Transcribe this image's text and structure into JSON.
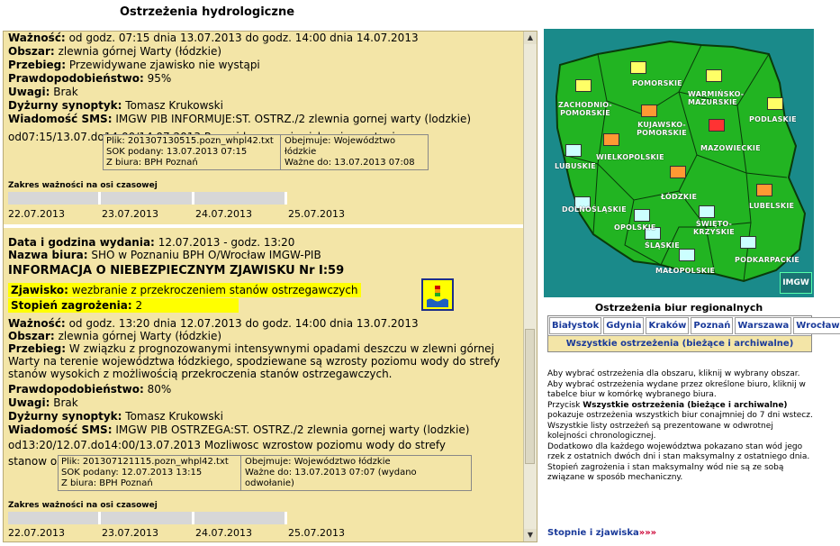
{
  "page_title": "Ostrzeżenia hydrologiczne",
  "record1": {
    "waznosc_label": "Ważność:",
    "waznosc_value": "od godz. 07:15 dnia 13.07.2013 do godz. 14:00 dnia 14.07.2013",
    "obszar_label": "Obszar:",
    "obszar_value": "zlewnia górnej Warty (łódzkie)",
    "przebieg_label": "Przebieg:",
    "przebieg_value": "Przewidywane zjawisko nie wystąpi",
    "prawdop_label": "Prawdopodobieństwo:",
    "prawdop_value": "95%",
    "uwagi_label": "Uwagi:",
    "uwagi_value": "Brak",
    "synoptyk_label": "Dyżurny synoptyk:",
    "synoptyk_value": "Tomasz Krukowski",
    "sms_label": "Wiadomość SMS:",
    "sms_value": "IMGW PIB INFORMUJE:ST. OSTRZ./2 zlewnia gornej warty (lodzkie)",
    "sms_cont": "od07:15/13.07.do14:00/14.07.2013 Przewidywane zjawisko nie wystapi",
    "plik": "Plik: 201307130515.pozn_whpl42.txt",
    "sok": "SOK podany: 13.07.2013 07:15",
    "biuro": "Z biura: BPH Poznań",
    "obejmuje": "Obejmuje: Województwo łódzkie",
    "wazne_do": "Ważne do: 13.07.2013 07:08",
    "zakres": "Zakres ważności na osi czasowej",
    "dates": [
      "22.07.2013",
      "23.07.2013",
      "24.07.2013",
      "25.07.2013"
    ]
  },
  "record2": {
    "data_label": "Data i godzina wydania:",
    "data_value": "12.07.2013 - godz. 13:20",
    "biuro_label": "Nazwa biura:",
    "biuro_value": "SHO w Poznaniu BPH O/Wrocław IMGW-PIB",
    "heading": "INFORMACJA O NIEBEZPIECZNYM ZJAWISKU Nr I:59",
    "zjawisko_label": "Zjawisko:",
    "zjawisko_value": "wezbranie z przekroczeniem stanów ostrzegawczych",
    "stopien_label": "Stopień zagrożenia:",
    "stopien_value": "2",
    "waznosc_label": "Ważność:",
    "waznosc_value": "od godz. 13:20 dnia 12.07.2013 do godz. 14:00 dnia 13.07.2013",
    "obszar_label": "Obszar:",
    "obszar_value": "zlewnia górnej Warty (łódzkie)",
    "przebieg_label": "Przebieg:",
    "przebieg_value": "W związku z prognozowanymi intensywnymi opadami deszczu w zlewni górnej Warty na terenie województwa łódzkiego, spodziewane są wzrosty poziomu wody do strefy stanów wysokich z możliwością przekroczenia stanów ostrzegawczych.",
    "prawdop_label": "Prawdopodobieństwo:",
    "prawdop_value": "80%",
    "uwagi_label": "Uwagi:",
    "uwagi_value": "Brak",
    "synoptyk_label": "Dyżurny synoptyk:",
    "synoptyk_value": "Tomasz Krukowski",
    "sms_label": "Wiadomość SMS:",
    "sms_value": "IMGW PIB OSTRZEGA:ST. OSTRZ./2 zlewnia gornej warty (lodzkie)",
    "sms_cont": "od13:20/12.07.do14:00/13.07.2013 Mozliwosc wzrostow poziomu wody do strefy stanow ostrzegawczych",
    "plik": "Plik: 201307121115.pozn_whpl42.txt",
    "sok": "SOK podany: 12.07.2013 13:15",
    "biuro": "Z biura: BPH Poznań",
    "obejmuje": "Obejmuje: Województwo łódzkie",
    "wazne_do": "Ważne do: 13.07.2013 07:07 (wydano odwołanie)",
    "zakres": "Zakres ważności na osi czasowej",
    "dates": [
      "22.07.2013",
      "23.07.2013",
      "24.07.2013",
      "25.07.2013"
    ]
  },
  "map": {
    "regions": [
      "ZACHODNIO-POMORSKIE",
      "POMORSKIE",
      "WARMIŃSKO-MAZURSKIE",
      "PODLASKIE",
      "KUJAWSKO-POMORSKIE",
      "MAZOWIECKIE",
      "LUBUSKIE",
      "WIELKOPOLSKIE",
      "ŁÓDZKIE",
      "LUBELSKIE",
      "DOLNOŚLĄSKIE",
      "OPOLSKIE",
      "ŚLĄSKIE",
      "ŚWIĘTO-KRZYSKIE",
      "PODKARPACKIE",
      "MAŁOPOLSKIE"
    ],
    "logo": "IMGW",
    "colors": {
      "land": "#22b422",
      "sea": "#1a8a8a",
      "border": "#0a3a0a",
      "alert": "#ff0000"
    }
  },
  "regional": {
    "title": "Ostrzeżenia biur regionalnych",
    "offices": [
      "Białystok",
      "Gdynia",
      "Kraków",
      "Poznań",
      "Warszawa",
      "Wrocław"
    ],
    "all_link": "Wszystkie ostrzeżenia (bieżące i archiwalne)"
  },
  "help": {
    "p1": "Aby wybrać ostrzeżenia dla obszaru, kliknij w wybrany obszar.",
    "p2": "Aby wybrać ostrzeżenia wydane przez określone biuro, kliknij w tabelce biur w komórkę wybranego biura.",
    "p3_pre": "Przycisk ",
    "p3_bold": "Wszystkie ostrzeżenia (bieżące i archiwalne)",
    "p3_post": " pokazuje ostrzeżenia wszystkich biur conajmniej do 7 dni wstecz.",
    "p4": "Wszystkie listy ostrzeżeń są prezentowane w odwrotnej kolejności chronologicznej.",
    "p5": "Dodatkowo dla każdego województwa pokazano stan wód jego rzek z ostatnich dwóch dni i stan maksymalny z ostatniego dnia.",
    "p6": "Stopień zagrożenia i stan maksymalny wód nie są ze sobą związane w sposób mechaniczny."
  },
  "stopnie_link": "Stopnie i zjawiska",
  "stopnie_arrows": "»»»"
}
